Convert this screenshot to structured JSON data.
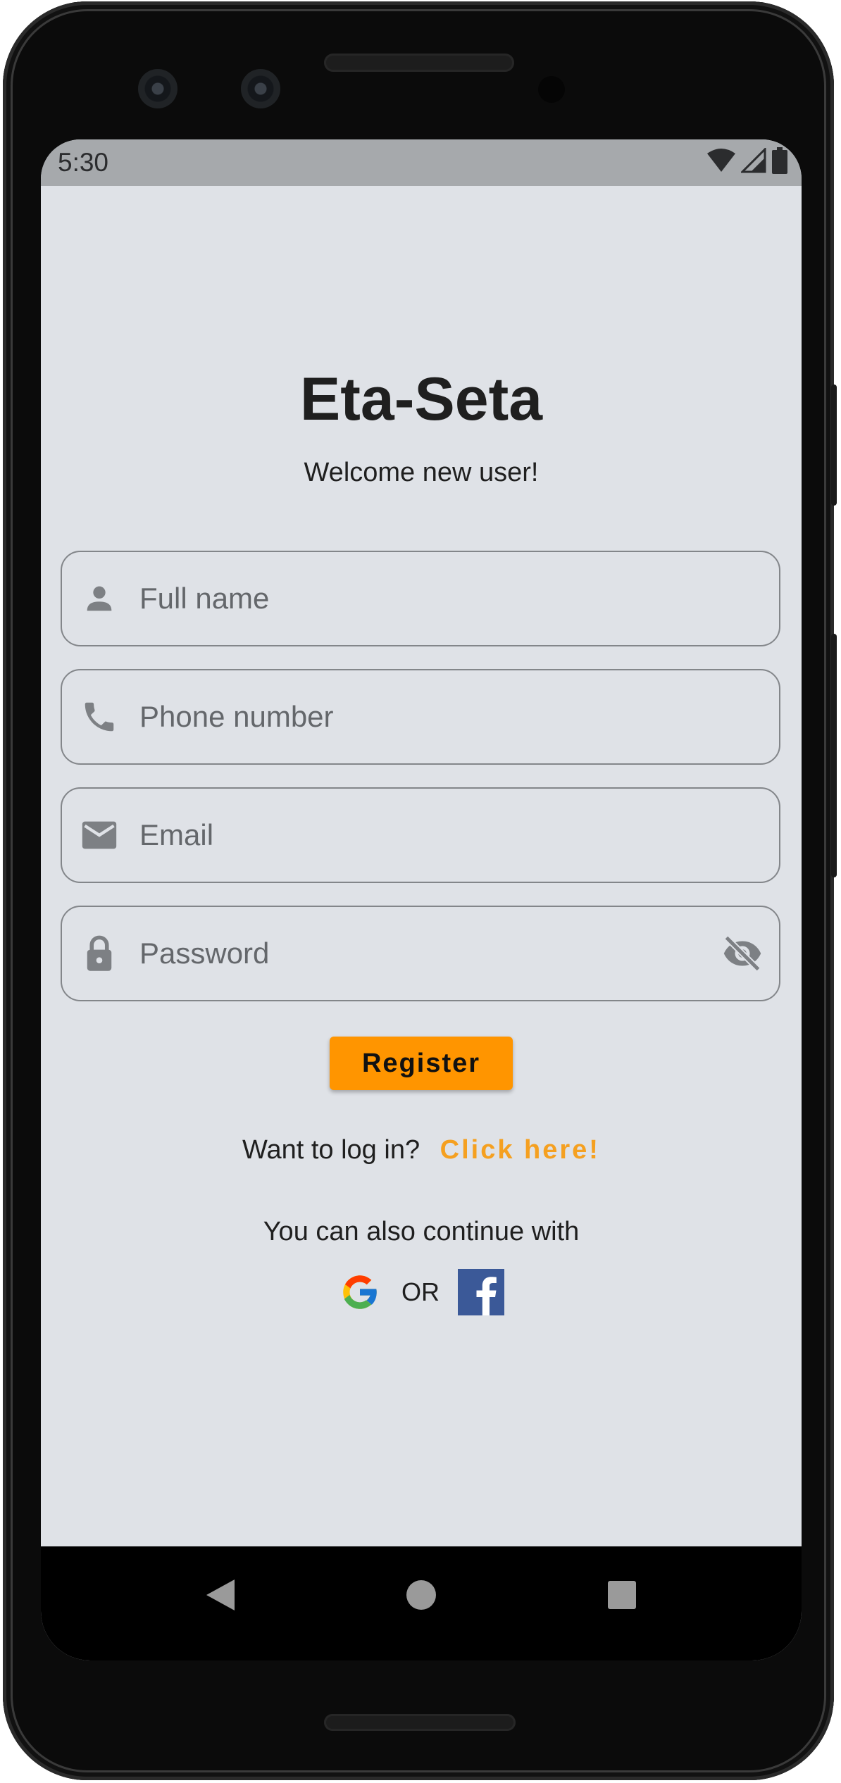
{
  "status_bar": {
    "time": "5:30",
    "icons": [
      "wifi-icon",
      "signal-icon",
      "battery-icon"
    ]
  },
  "header": {
    "title": "Eta-Seta",
    "subtitle": "Welcome new user!"
  },
  "form": {
    "full_name": {
      "icon": "person-icon",
      "placeholder": "Full name",
      "value": ""
    },
    "phone": {
      "icon": "phone-icon",
      "placeholder": "Phone number",
      "value": ""
    },
    "email": {
      "icon": "mail-icon",
      "placeholder": "Email",
      "value": ""
    },
    "password": {
      "icon": "lock-icon",
      "placeholder": "Password",
      "value": "",
      "toggle_icon": "visibility-off-icon"
    },
    "register_label": "Register"
  },
  "login": {
    "prompt": "Want to log in?",
    "link_label": "Click here!"
  },
  "social": {
    "prompt": "You can also continue with",
    "separator": "OR",
    "providers": [
      "google-logo",
      "facebook-logo"
    ]
  },
  "nav_bar": {
    "buttons": [
      "back-icon",
      "home-icon",
      "recents-icon"
    ]
  },
  "colors": {
    "accent": "#ff9500",
    "link": "#f5a020",
    "background": "#dfe2e7",
    "status_bar": "#a6a9ac",
    "field_border": "#83868a",
    "icon": "#7d8084"
  }
}
